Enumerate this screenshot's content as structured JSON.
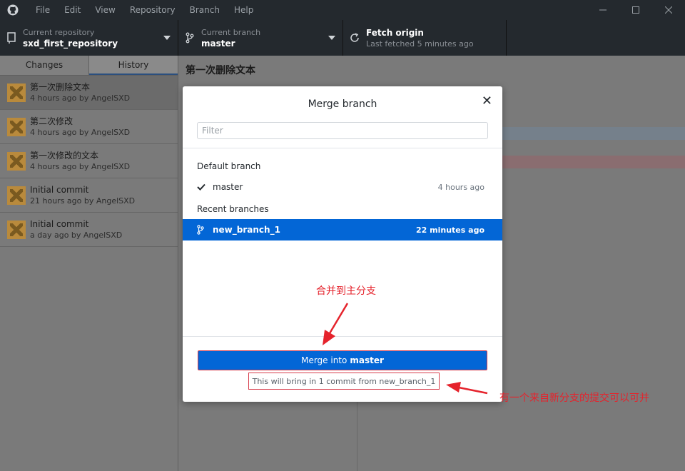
{
  "menu": [
    "File",
    "Edit",
    "View",
    "Repository",
    "Branch",
    "Help"
  ],
  "toolbar": {
    "repo_sub": "Current repository",
    "repo_name": "sxd_first_repository",
    "branch_sub": "Current branch",
    "branch_name": "master",
    "fetch_title": "Fetch origin",
    "fetch_sub": "Last fetched 5 minutes ago"
  },
  "sidebar": {
    "tabs": [
      "Changes",
      "History"
    ],
    "active_tab": "History",
    "commits": [
      {
        "title": "第一次删除文本",
        "meta": "4 hours ago by AngelSXD"
      },
      {
        "title": "第二次修改",
        "meta": "4 hours ago by AngelSXD"
      },
      {
        "title": "第一次修改的文本",
        "meta": "4 hours ago by AngelSXD"
      },
      {
        "title": "Initial commit",
        "meta": "21 hours ago by AngelSXD"
      },
      {
        "title": "Initial commit",
        "meta": "a day ago by AngelSXD"
      }
    ]
  },
  "main": {
    "commit_title": "第一次删除文本"
  },
  "modal": {
    "title": "Merge branch",
    "close_glyph": "✕",
    "filter_placeholder": "Filter",
    "default_section": "Default branch",
    "default_branch": {
      "name": "master",
      "time": "4 hours ago"
    },
    "recent_section": "Recent branches",
    "recent_branch": {
      "name": "new_branch_1",
      "time": "22 minutes ago"
    },
    "merge_prefix": "Merge into",
    "merge_target": "master",
    "info": "This will bring in 1 commit from new_branch_1"
  },
  "annotations": {
    "merge_note": "合并到主分支",
    "commit_note": "有一个来自新分支的提交可以可并"
  },
  "colors": {
    "accent": "#0366d6",
    "annotation": "#e5232c",
    "titlebar": "#24292e"
  }
}
